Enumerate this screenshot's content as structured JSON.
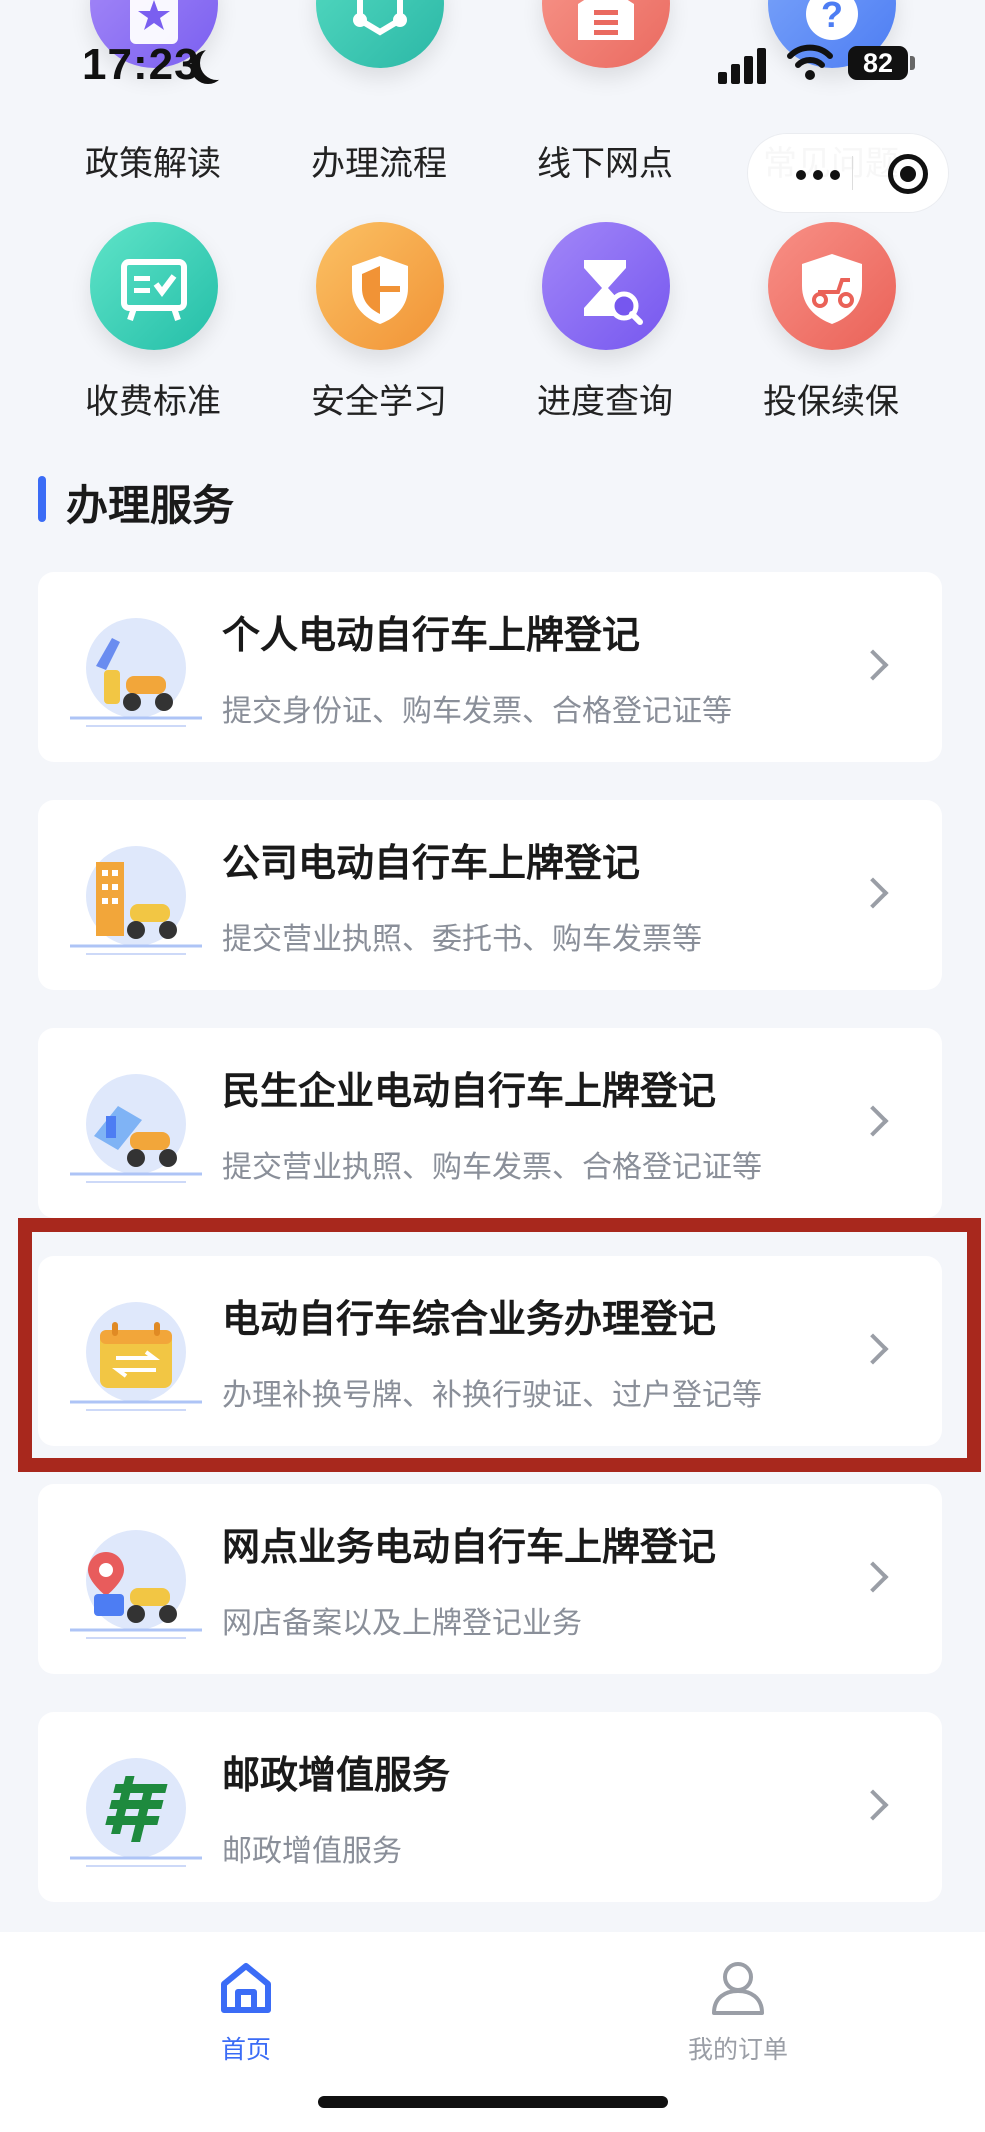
{
  "status_bar": {
    "time": "17:23",
    "battery": "82"
  },
  "grid": {
    "row1": [
      {
        "label": "政策解读",
        "icon": "star-document-icon",
        "color": "#8b6ef0"
      },
      {
        "label": "办理流程",
        "icon": "network-hex-icon",
        "color": "#3cc8b0"
      },
      {
        "label": "线下网点",
        "icon": "store-icon",
        "color": "#f07a6e"
      },
      {
        "label": "常见问题",
        "icon": "question-icon",
        "color": "#5b8cf7"
      }
    ],
    "row2": [
      {
        "label": "收费标准",
        "icon": "fee-board-icon",
        "color": "#34cdb3"
      },
      {
        "label": "安全学习",
        "icon": "shield-icon",
        "color": "#f4a54a"
      },
      {
        "label": "进度查询",
        "icon": "hourglass-search-icon",
        "color": "#8c6cf3"
      },
      {
        "label": "投保续保",
        "icon": "scooter-shield-icon",
        "color": "#f0766c"
      }
    ]
  },
  "section": {
    "title": "办理服务"
  },
  "services": [
    {
      "title": "个人电动自行车上牌登记",
      "subtitle": "提交身份证、购车发票、合格登记证等",
      "icon": "person-scooter-icon"
    },
    {
      "title": "公司电动自行车上牌登记",
      "subtitle": "提交营业执照、委托书、购车发票等",
      "icon": "building-scooter-icon"
    },
    {
      "title": "民生企业电动自行车上牌登记",
      "subtitle": "提交营业执照、购车发票、合格登记证等",
      "icon": "enterprise-scooter-icon"
    },
    {
      "title": "电动自行车综合业务办理登记",
      "subtitle": "办理补换号牌、补换行驶证、过户登记等",
      "icon": "calendar-transfer-icon"
    },
    {
      "title": "网点业务电动自行车上牌登记",
      "subtitle": "网店备案以及上牌登记业务",
      "icon": "map-pin-scooter-icon"
    },
    {
      "title": "邮政增值服务",
      "subtitle": "邮政增值服务",
      "icon": "china-post-icon"
    }
  ],
  "tabbar": {
    "home": {
      "label": "首页",
      "color": "#3b6cf6"
    },
    "orders": {
      "label": "我的订单",
      "color": "#9a9ea6"
    }
  },
  "colors": {
    "accent": "#3b6cf6",
    "highlight": "#a8281d"
  }
}
